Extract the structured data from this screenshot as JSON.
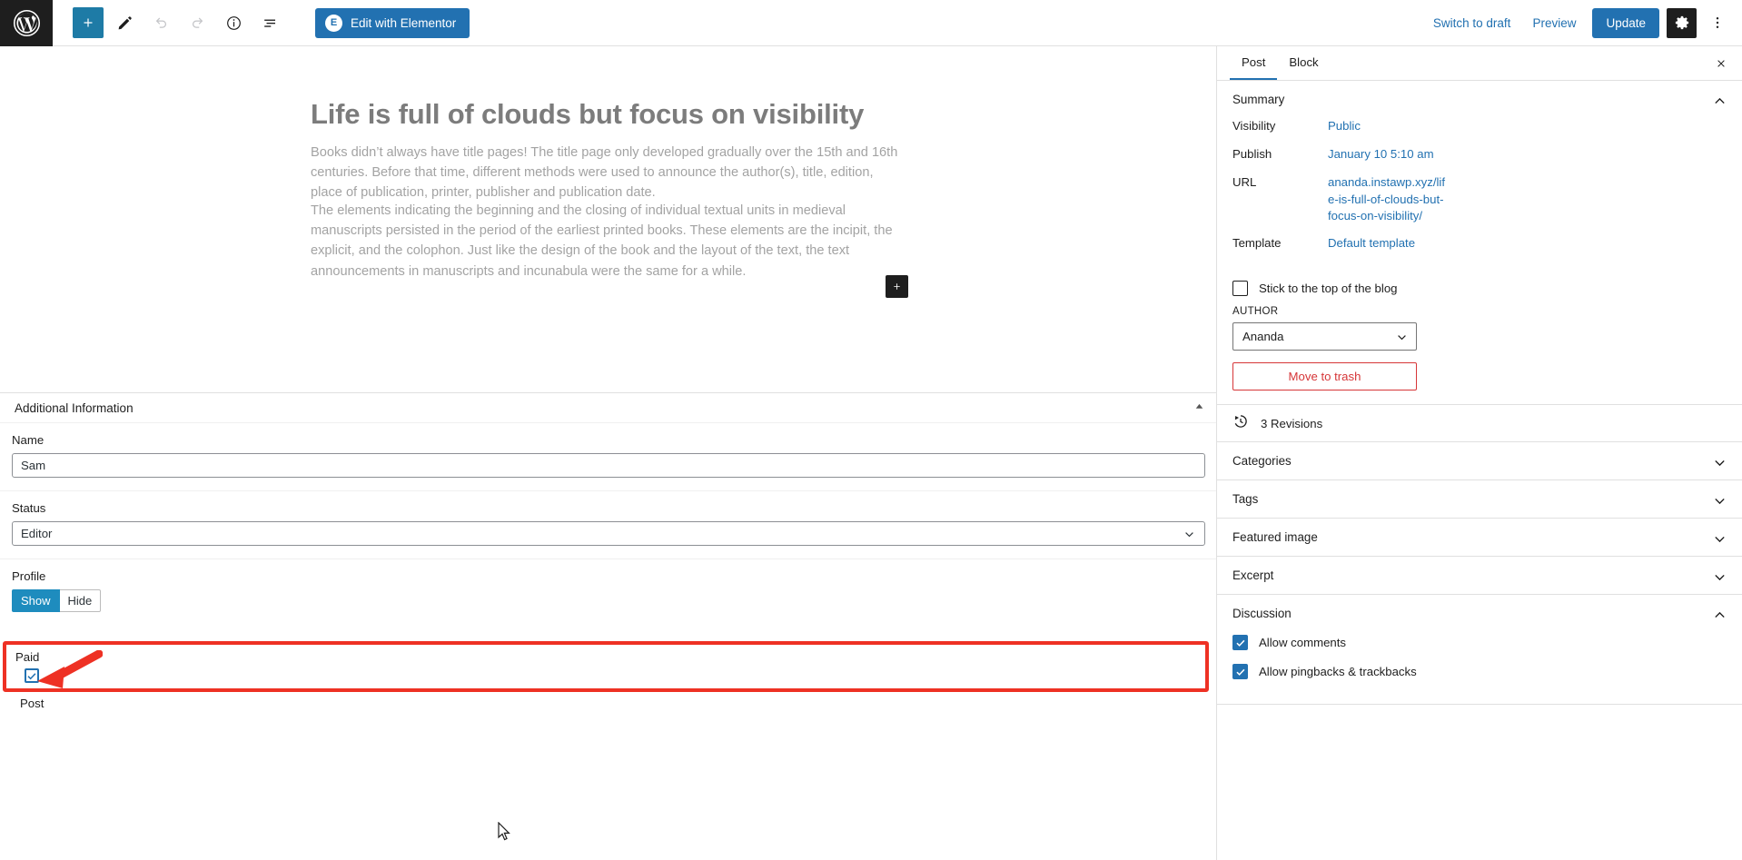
{
  "topbar": {
    "logo_icon": "wordpress-logo-icon",
    "tools": [
      {
        "name": "add-block-button",
        "icon": "plus-icon",
        "label": "+"
      },
      {
        "name": "tools-pencil-button",
        "icon": "pencil-icon",
        "label": ""
      },
      {
        "name": "undo-button",
        "icon": "undo-arrow-icon",
        "label": ""
      },
      {
        "name": "redo-button",
        "icon": "redo-arrow-icon",
        "label": ""
      },
      {
        "name": "details-button",
        "icon": "info-circle-icon",
        "label": ""
      },
      {
        "name": "list-view-button",
        "icon": "list-view-icon",
        "label": ""
      }
    ],
    "elementor_button_label": "Edit with Elementor",
    "elementor_badge": "E",
    "switch_to_draft_label": "Switch to draft",
    "preview_label": "Preview",
    "update_label": "Update",
    "settings_icon": "gear-icon",
    "options_icon": "kebab-menu-icon",
    "accent_color": "#2271b1"
  },
  "editor": {
    "title": "Life is full of clouds but focus on visibility",
    "paragraph_1": "Books didn’t always have title pages! The title page only developed gradually over the 15th and 16th centuries. Before that time, different methods were used to announce the author(s), title, edition, place of publication, printer, publisher and publication date.",
    "paragraph_2": "The elements indicating the beginning and the closing of individual textual units in medieval manuscripts persisted in the period of the earliest printed books. These elements are the incipit, the explicit, and the colophon. Just like the design of the book and the layout of the text, the text announcements in manuscripts and incunabula were the same for a while.",
    "inserter_icon": "plus-icon",
    "title_color": "#7c7c7c",
    "body_color": "#a3a3a3"
  },
  "metabox": {
    "title": "Additional Information",
    "collapse_icon": "caret-up-icon",
    "fields": {
      "name": {
        "label": "Name",
        "value": "Sam"
      },
      "status": {
        "label": "Status",
        "value": "Editor",
        "caret_icon": "chevron-down-icon"
      },
      "profile": {
        "label": "Profile",
        "options": [
          "Show",
          "Hide"
        ],
        "selected": "Show",
        "active_color": "#1e8cbe"
      },
      "paid": {
        "label": "Paid",
        "checked": true,
        "highlight_color": "#ee3124",
        "check_icon": "checkmark-icon"
      }
    },
    "footer_label": "Post"
  },
  "annotation": {
    "arrow_color": "#ee3124",
    "arrow_icon": "arrow-pointer-annotation"
  },
  "cursor": {
    "icon": "mouse-pointer-icon"
  },
  "sidebar": {
    "tabs": [
      {
        "label": "Post",
        "active": true
      },
      {
        "label": "Block",
        "active": false
      }
    ],
    "close_icon": "close-icon",
    "summary": {
      "title": "Summary",
      "chevron_icon": "chevron-up-icon",
      "rows": [
        {
          "key": "Visibility",
          "value": "Public"
        },
        {
          "key": "Publish",
          "value": "January 10 5:10 am"
        },
        {
          "key": "URL",
          "value": "ananda.instawp.xyz/life-is-full-of-clouds-but-focus-on-visibility/"
        },
        {
          "key": "Template",
          "value": "Default template"
        }
      ],
      "sticky": {
        "label": "Stick to the top of the blog",
        "checked": false
      },
      "author": {
        "caption": "AUTHOR",
        "value": "Ananda",
        "caret_icon": "chevron-down-icon"
      },
      "trash_label": "Move to trash"
    },
    "revisions": {
      "label": "3 Revisions",
      "icon": "revision-clock-icon"
    },
    "sections": [
      {
        "label": "Categories",
        "chevron_icon": "chevron-down-icon",
        "expanded": false
      },
      {
        "label": "Tags",
        "chevron_icon": "chevron-down-icon",
        "expanded": false
      },
      {
        "label": "Featured image",
        "chevron_icon": "chevron-down-icon",
        "expanded": false
      },
      {
        "label": "Excerpt",
        "chevron_icon": "chevron-down-icon",
        "expanded": false
      }
    ],
    "discussion": {
      "label": "Discussion",
      "chevron_icon": "chevron-up-icon",
      "options": [
        {
          "label": "Allow comments",
          "checked": true
        },
        {
          "label": "Allow pingbacks & trackbacks",
          "checked": true
        }
      ]
    },
    "link_color": "#2271b1",
    "danger_color": "#d63638"
  }
}
